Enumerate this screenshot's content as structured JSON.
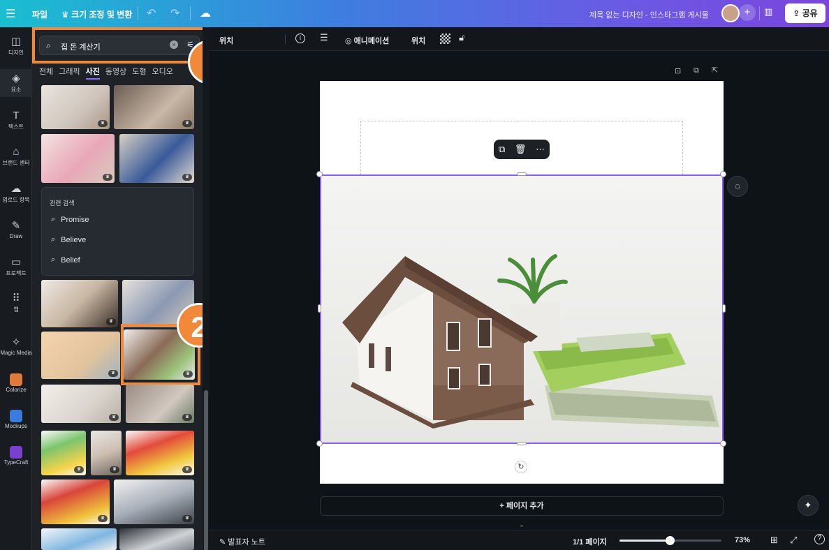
{
  "topbar": {
    "file": "파일",
    "resize": "크기 조정 및 변환",
    "doc_title": "제목 없는 디자인 - 인스타그램 게시물",
    "share": "공유"
  },
  "rail": [
    {
      "label": "디자인",
      "icon": "design-icon"
    },
    {
      "label": "요소",
      "icon": "elements-icon"
    },
    {
      "label": "텍스트",
      "icon": "text-icon"
    },
    {
      "label": "브랜드 센터",
      "icon": "brand-icon"
    },
    {
      "label": "업로드 항목",
      "icon": "upload-icon"
    },
    {
      "label": "Draw",
      "icon": "draw-icon"
    },
    {
      "label": "프로젝트",
      "icon": "folder-icon"
    },
    {
      "label": "앱",
      "icon": "apps-icon"
    },
    {
      "label": "Magic Media",
      "icon": "magic-media-icon"
    },
    {
      "label": "Colorize",
      "icon": "colorize-icon"
    },
    {
      "label": "Mockups",
      "icon": "mockups-icon"
    },
    {
      "label": "TypeCraft",
      "icon": "typecraft-icon"
    }
  ],
  "search": {
    "value": "집 돈 계산기"
  },
  "tabs": [
    "전체",
    "그래픽",
    "사진",
    "동영상",
    "도형",
    "오디오"
  ],
  "related": {
    "title": "관련 검색",
    "items": [
      "Promise",
      "Believe",
      "Belief"
    ]
  },
  "badges": {
    "one": "1",
    "two": "2"
  },
  "ctxbar": {
    "position_left": "위치",
    "animate": "애니메이션",
    "position": "위치"
  },
  "canvas": {
    "add_page": "+ 페이지 추가"
  },
  "bottom": {
    "notes": "발표자 노트",
    "page": "1/1 페이지",
    "zoom": "73%",
    "zoom_level": 0.73
  },
  "colors": {
    "highlight": "#f08a3a",
    "selection": "#8b5cf6"
  }
}
